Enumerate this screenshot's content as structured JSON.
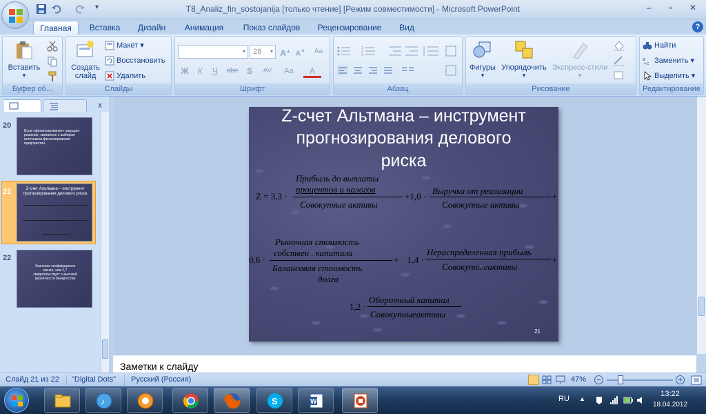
{
  "window": {
    "title": "T8_Analiz_fin_sostojanija [только чтение] [Режим совместимости] - Microsoft PowerPoint",
    "controls": [
      "–",
      "▫",
      "✕"
    ]
  },
  "tabs": [
    "Главная",
    "Вставка",
    "Дизайн",
    "Анимация",
    "Показ слайдов",
    "Рецензирование",
    "Вид"
  ],
  "active_tab": "Главная",
  "ribbon": {
    "clipboard": {
      "paste": "Вставить",
      "label": "Буфер об..."
    },
    "slides": {
      "new_slide": "Создать слайд",
      "layout": "Макет",
      "reset": "Восстановить",
      "delete": "Удалить",
      "label": "Слайды"
    },
    "font": {
      "size": "28",
      "label": "Шрифт",
      "buttons": [
        "Ж",
        "К",
        "Ч",
        "abe",
        "S",
        "AV",
        "Aa",
        "A"
      ]
    },
    "paragraph": {
      "label": "Абзац"
    },
    "drawing": {
      "shapes": "Фигуры",
      "arrange": "Упорядочить",
      "quick_styles": "Экспресс-стили",
      "label": "Рисование"
    },
    "editing": {
      "find": "Найти",
      "replace": "Заменить",
      "select": "Выделить",
      "label": "Редактирование"
    }
  },
  "thumbnails": [
    {
      "num": "20",
      "text": "Если «финансирование» ощущает решение, связанное с выбором источников финансирования предприятия."
    },
    {
      "num": "21",
      "text": "Z-счет Альтмана – инструмент прогнозирования делового риска"
    },
    {
      "num": "22",
      "text": "Значение коэффициента менее, чем 2,7 свидетельствует о высокой вероятности банкротства"
    }
  ],
  "slide": {
    "title_lines": [
      "Z-счет Альтмана – инструмент",
      "прогнозирования делового",
      "риска"
    ],
    "number": "21",
    "formula": {
      "z": "Z = 3,3 ·",
      "t1_num_1": "Прибыль до выплаты",
      "t1_num_2": "процентов  и налогов",
      "t1_den": "Совокупные  активы",
      "c2": "+1,0 ·",
      "t2_num": "Выручка  от реализации",
      "t2_den": "Совокупные  активы",
      "plus1": "+",
      "c3": "0,6 ·",
      "t3_num_1": "Рыночная  стоимость",
      "t3_num_2": "собствен .  капитала",
      "t3_den_1": "Балансовая  стоимость",
      "t3_den_2": "долга",
      "plus2": "+",
      "c4": "1,4 ·",
      "t4_num": "Нераспределенная прибыль",
      "t4_den": "Совокупныеактивы",
      "plus3": "+",
      "c5": "1,2 ·",
      "t5_num": "Оборотный капитал",
      "t5_den": "Совокупныеактивы"
    }
  },
  "notes": {
    "placeholder": "Заметки к слайду"
  },
  "status": {
    "slide": "Слайд 21 из 22",
    "theme": "\"Digital Dots\"",
    "lang": "Русский (Россия)",
    "zoom": "47%"
  },
  "taskbar": {
    "lang": "RU",
    "time": "13:22",
    "date": "18.04.2012"
  }
}
